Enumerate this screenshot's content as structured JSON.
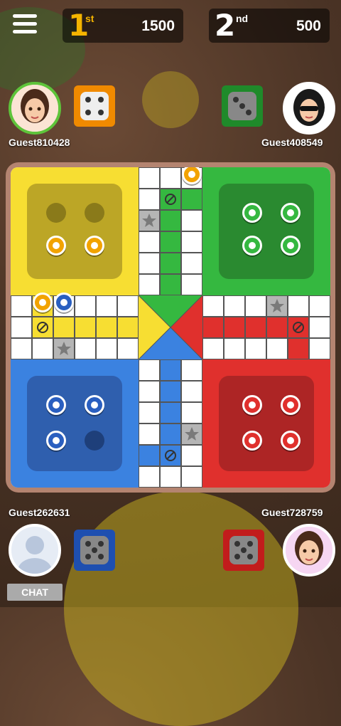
{
  "top_bar": {
    "menu_icon": "hamburger-menu-icon",
    "rank1": {
      "number": "1",
      "suffix": "st",
      "score": "1500",
      "color": "#f5b400"
    },
    "rank2": {
      "number": "2",
      "suffix": "nd",
      "score": "500",
      "color": "#ffffff"
    }
  },
  "players": {
    "top_left": {
      "name": "Guest810428",
      "ring_color": "#5ec43a",
      "dice_color": "#f08a00"
    },
    "top_right": {
      "name": "Guest408549",
      "dice_color": "#1f8a2a"
    },
    "bottom_left": {
      "name": "Guest262631",
      "dice_color": "#1e4fb0"
    },
    "bottom_right": {
      "name": "Guest728759",
      "dice_color": "#c21c1c"
    }
  },
  "board_colors": {
    "yellow": "#f7de32",
    "green": "#35b840",
    "blue": "#3b82e0",
    "red": "#e0302d"
  },
  "chat": {
    "label": "CHAT"
  }
}
